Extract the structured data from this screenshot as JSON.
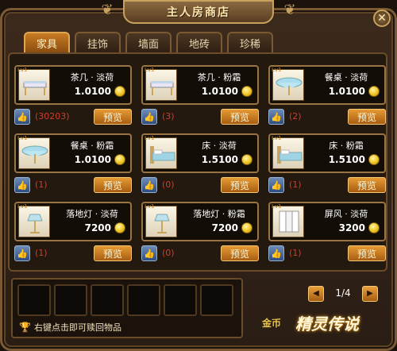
{
  "window": {
    "title": "主人房商店"
  },
  "tabs": [
    {
      "label": "家具",
      "active": true
    },
    {
      "label": "挂饰"
    },
    {
      "label": "墙面"
    },
    {
      "label": "地砖"
    },
    {
      "label": "珍稀"
    }
  ],
  "items": [
    {
      "level": "Lv1",
      "name": "茶几 · 淡荷",
      "price": "1.0100",
      "likes": "(30203)",
      "preview": "预览",
      "icon": "tea-table"
    },
    {
      "level": "Lv1",
      "name": "茶几 · 粉霜",
      "price": "1.0100",
      "likes": "(3)",
      "preview": "预览",
      "icon": "tea-table"
    },
    {
      "level": "Lv1",
      "name": "餐桌 · 淡荷",
      "price": "1.0100",
      "likes": "(2)",
      "preview": "预览",
      "icon": "dining-table"
    },
    {
      "level": "Lv1",
      "name": "餐桌 · 粉霜",
      "price": "1.0100",
      "likes": "(1)",
      "preview": "预览",
      "icon": "dining-table"
    },
    {
      "level": "Lv1",
      "name": "床 · 淡荷",
      "price": "1.5100",
      "likes": "(0)",
      "preview": "预览",
      "icon": "bed"
    },
    {
      "level": "Lv1",
      "name": "床 · 粉霜",
      "price": "1.5100",
      "likes": "(1)",
      "preview": "预览",
      "icon": "bed"
    },
    {
      "level": "Lv1",
      "name": "落地灯 · 淡荷",
      "price": "7200",
      "likes": "(1)",
      "preview": "预览",
      "icon": "floor-lamp"
    },
    {
      "level": "Lv1",
      "name": "落地灯 · 粉霜",
      "price": "7200",
      "likes": "(0)",
      "preview": "预览",
      "icon": "floor-lamp"
    },
    {
      "level": "Lv1",
      "name": "屏风 · 淡荷",
      "price": "3200",
      "likes": "(1)",
      "preview": "预览",
      "icon": "folding-screen"
    }
  ],
  "redeem": {
    "hint": "右键点击即可赎回物品",
    "slot_count": 6
  },
  "pager": {
    "text": "1/4"
  },
  "footer": {
    "gold_label": "金币",
    "brand": "精灵传说"
  }
}
